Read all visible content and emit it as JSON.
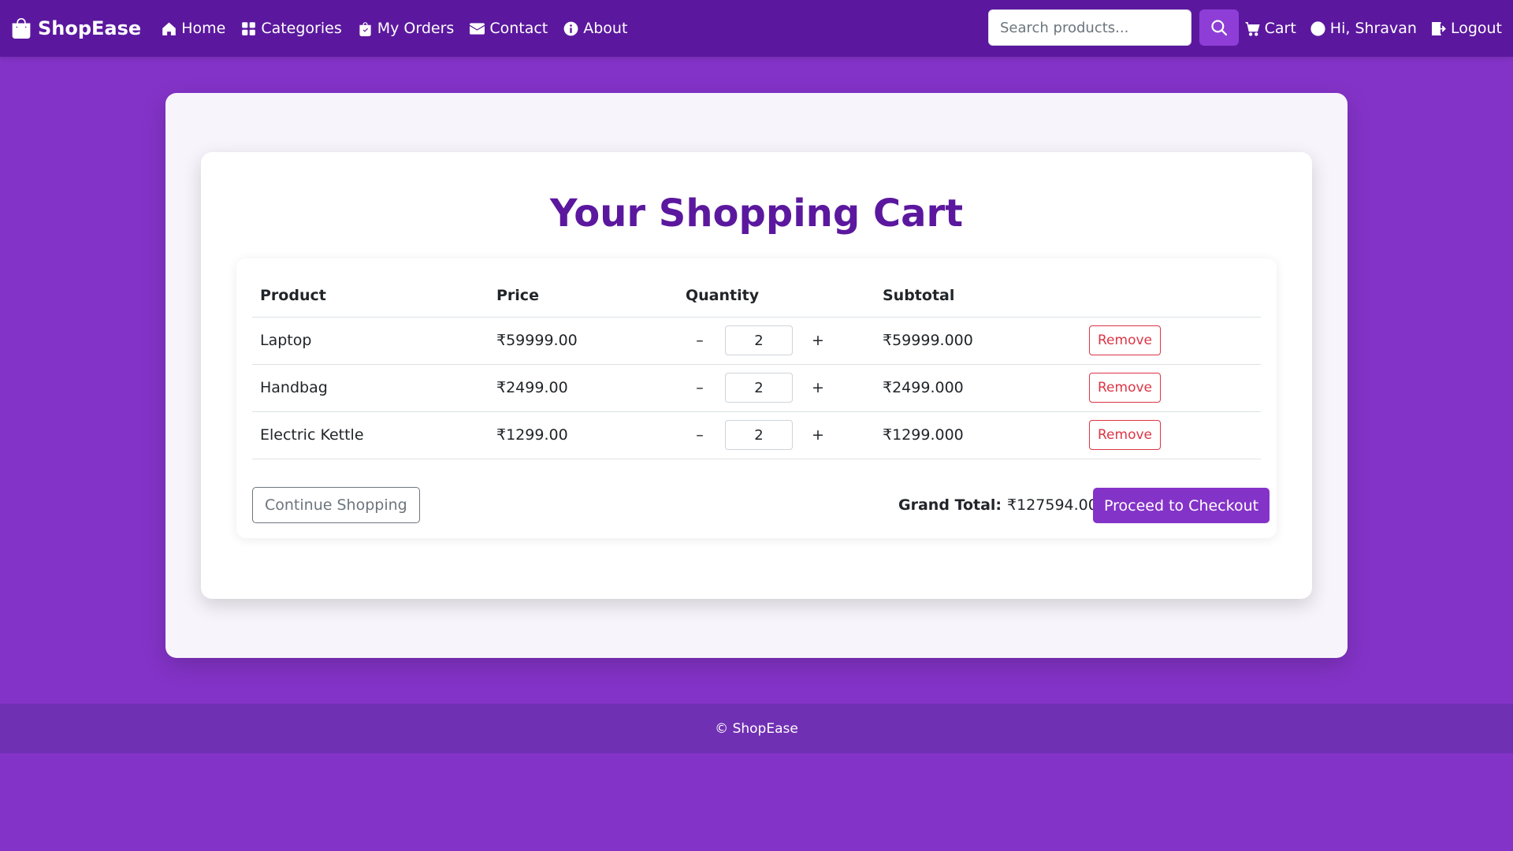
{
  "brand": {
    "name": "ShopEase",
    "icon": "shopping-bag-icon"
  },
  "nav": {
    "links": [
      {
        "label": "Home",
        "icon": "house-icon"
      },
      {
        "label": "Categories",
        "icon": "grid-icon"
      },
      {
        "label": "My Orders",
        "icon": "bag-check-icon"
      },
      {
        "label": "Contact",
        "icon": "envelope-icon"
      },
      {
        "label": "About",
        "icon": "info-circle-icon"
      }
    ],
    "search": {
      "placeholder": "Search products...",
      "value": "",
      "button_icon": "search-icon"
    },
    "right": [
      {
        "label": "Cart",
        "icon": "cart-icon"
      },
      {
        "label": "Hi, Shravan",
        "icon": "person-circle-icon"
      },
      {
        "label": "Logout",
        "icon": "logout-icon"
      }
    ]
  },
  "cart": {
    "title": "Your Shopping Cart",
    "columns": [
      "Product",
      "Price",
      "Quantity",
      "Subtotal"
    ],
    "items": [
      {
        "product": "Laptop",
        "price": "₹59999.00",
        "quantity": "2",
        "subtotal": "₹59999.000",
        "remove_label": "Remove"
      },
      {
        "product": "Handbag",
        "price": "₹2499.00",
        "quantity": "2",
        "subtotal": "₹2499.000",
        "remove_label": "Remove"
      },
      {
        "product": "Electric Kettle",
        "price": "₹1299.00",
        "quantity": "2",
        "subtotal": "₹1299.000",
        "remove_label": "Remove"
      }
    ],
    "qty_minus": "–",
    "qty_plus": "+",
    "continue_label": "Continue Shopping",
    "grand_total_label": "Grand Total:",
    "grand_total_value": "₹127594.00",
    "checkout_label": "Proceed to Checkout"
  },
  "footer": {
    "text": "© ShopEase"
  },
  "colors": {
    "navbar": "#5b189e",
    "page_bg": "#8433c8",
    "accent": "#8433c8",
    "title": "#5b189e",
    "danger": "#dc3545"
  }
}
